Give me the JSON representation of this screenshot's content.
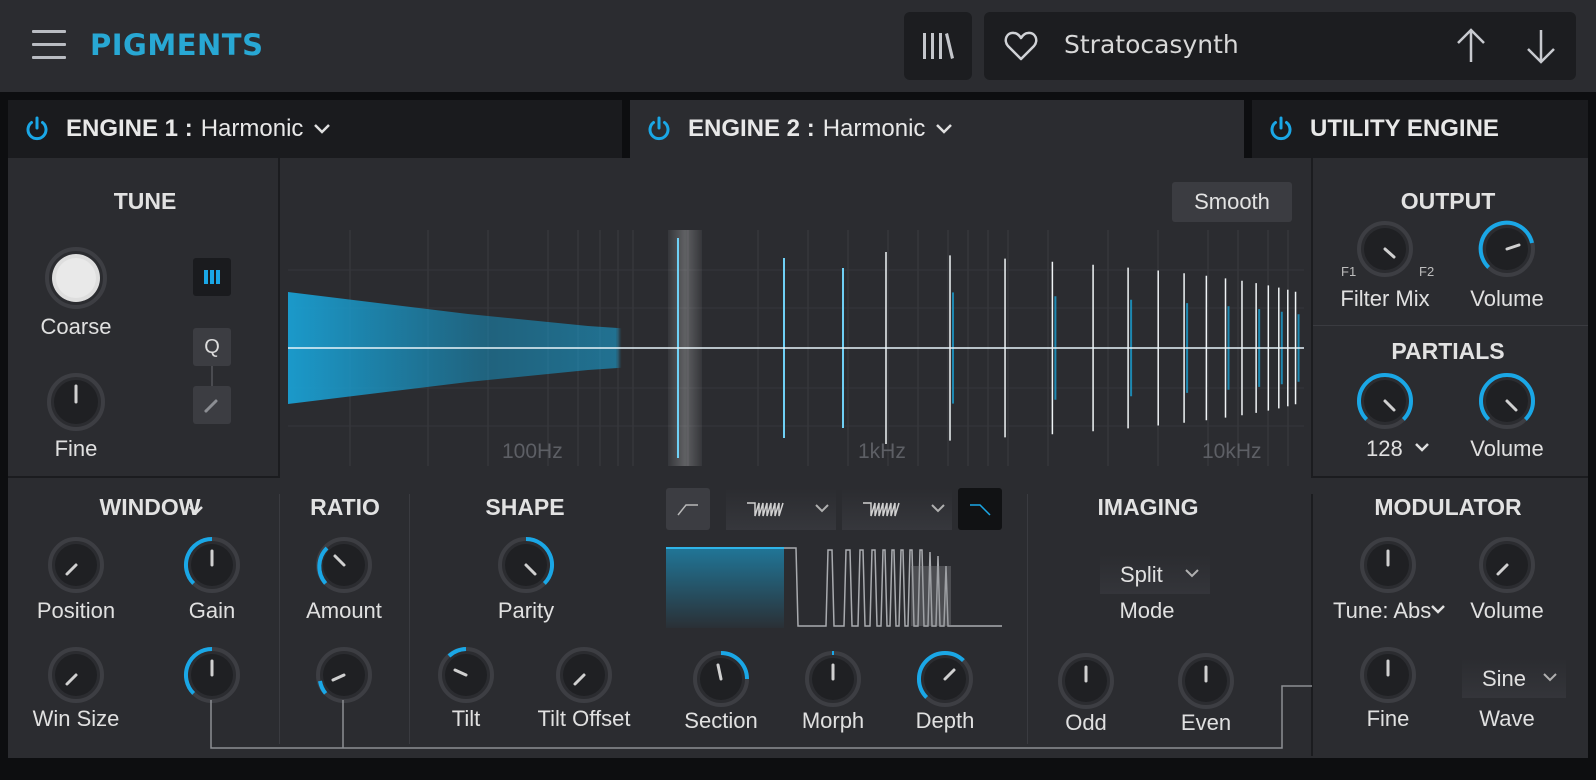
{
  "app": {
    "logo": "PIGMENTS",
    "preset_name": "Stratocasynth"
  },
  "tabs": {
    "engine1": {
      "label": "ENGINE 1 :",
      "value": "Harmonic"
    },
    "engine2": {
      "label": "ENGINE 2 :",
      "value": "Harmonic"
    },
    "utility": {
      "label": "UTILITY ENGINE"
    }
  },
  "tune": {
    "title": "TUNE",
    "coarse": "Coarse",
    "fine": "Fine",
    "q_button": "Q"
  },
  "spectrum": {
    "smooth_button": "Smooth",
    "freq_labels": [
      "100Hz",
      "1kHz",
      "10kHz"
    ]
  },
  "output": {
    "title": "OUTPUT",
    "f1": "F1",
    "f2": "F2",
    "filter_mix": "Filter Mix",
    "volume": "Volume"
  },
  "partials": {
    "title": "PARTIALS",
    "count": "128",
    "volume": "Volume"
  },
  "window": {
    "title": "WINDOW",
    "position": "Position",
    "gain": "Gain",
    "win_size": "Win Size"
  },
  "ratio": {
    "title": "RATIO",
    "amount": "Amount"
  },
  "shape": {
    "title": "SHAPE",
    "parity": "Parity",
    "tilt": "Tilt",
    "tilt_offset": "Tilt Offset"
  },
  "morph": {
    "section": "Section",
    "morph": "Morph",
    "depth": "Depth"
  },
  "imaging": {
    "title": "IMAGING",
    "mode_value": "Split",
    "mode": "Mode",
    "odd": "Odd",
    "even": "Even"
  },
  "modulator": {
    "title": "MODULATOR",
    "tune_mode": "Tune: Abs",
    "volume": "Volume",
    "fine": "Fine",
    "wave_value": "Sine",
    "wave": "Wave"
  },
  "colors": {
    "accent": "#1aa7e6",
    "panel": "#2b2c30",
    "topbar": "#2b2c30",
    "logo": "#28a8d4"
  }
}
